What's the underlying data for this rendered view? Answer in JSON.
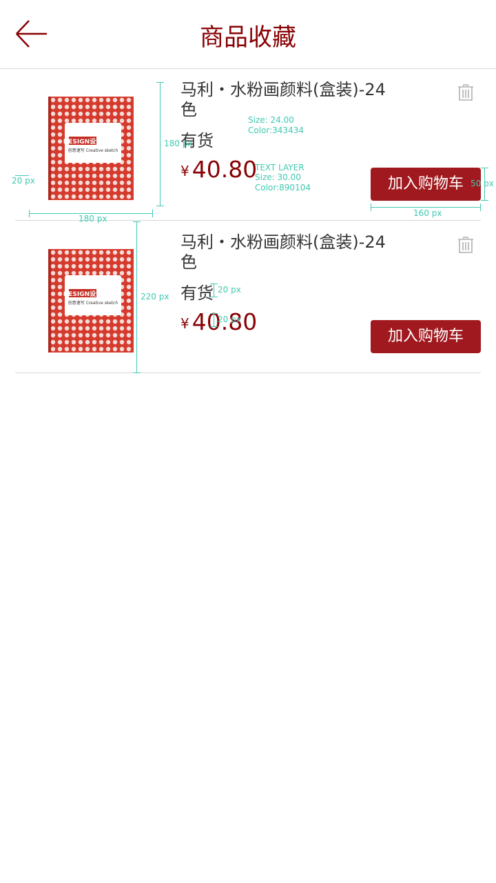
{
  "header": {
    "title": "商品收藏",
    "back_icon": "arrow-left-icon"
  },
  "items": [
    {
      "name": "马利・水粉画颜料(盒装)-24色",
      "stock": "有货",
      "currency": "¥",
      "price": "40.80",
      "button_label": "加入购物车",
      "delete_icon": "trash-icon",
      "image_text": {
        "brand": "DESIGN设计",
        "sub": "创意速写 Creative sketch"
      }
    },
    {
      "name": "马利・水粉画颜料(盒装)-24色",
      "stock": "有货",
      "currency": "¥",
      "price": "40.80",
      "button_label": "加入购物车",
      "delete_icon": "trash-icon",
      "image_text": {
        "brand": "DESIGN设计",
        "sub": "创意速写 Creative sketch"
      }
    }
  ],
  "annotations": {
    "thumb_height": "180 px",
    "thumb_width": "180 px",
    "thumb_gap": "20 px",
    "button_height": "50 px",
    "button_width": "160 px",
    "row_height": "220 px",
    "spacing_a": "20 px",
    "spacing_b": "20 px",
    "name_layer_size": "Size: 24.00",
    "name_layer_color": "Color:343434",
    "price_layer": "TEXT LAYER",
    "price_layer_size": "Size: 30.00",
    "price_layer_color": "Color:890104"
  },
  "colors": {
    "accent": "#890104",
    "button": "#a0191e",
    "text": "#343434",
    "annotation": "#3ec9b0"
  }
}
